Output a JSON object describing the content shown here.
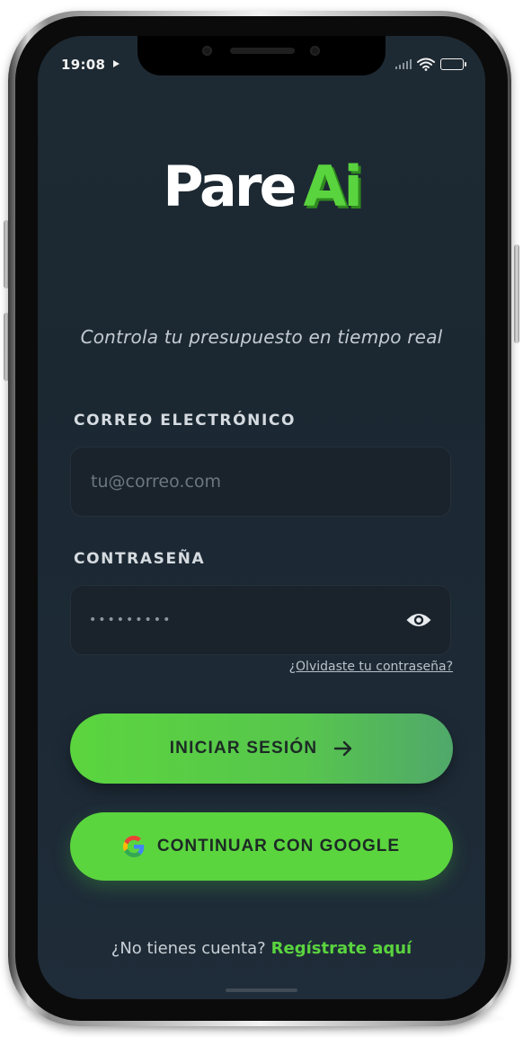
{
  "status_bar": {
    "time": "19:08",
    "battery": "95",
    "battery_level": 0.95
  },
  "brand": {
    "name_part1": "Pare",
    "name_part2": "Ai",
    "accent_color": "#5ad43e"
  },
  "tagline": "Controla tu presupuesto en tiempo real",
  "email": {
    "label": "CORREO ELECTRÓNICO",
    "placeholder": "tu@correo.com"
  },
  "password": {
    "label": "CONTRASEÑA",
    "masked_value": "•••••••••",
    "toggle_icon": "eye-icon"
  },
  "forgot_password": "¿Olvidaste tu contraseña?",
  "login_button": {
    "label": "INICIAR SESIÓN",
    "icon": "arrow-right-icon"
  },
  "google_button": {
    "label": "CONTINUAR CON GOOGLE",
    "icon": "google-icon"
  },
  "signup": {
    "prompt": "¿No tienes cuenta?",
    "link": "Regístrate aquí"
  }
}
